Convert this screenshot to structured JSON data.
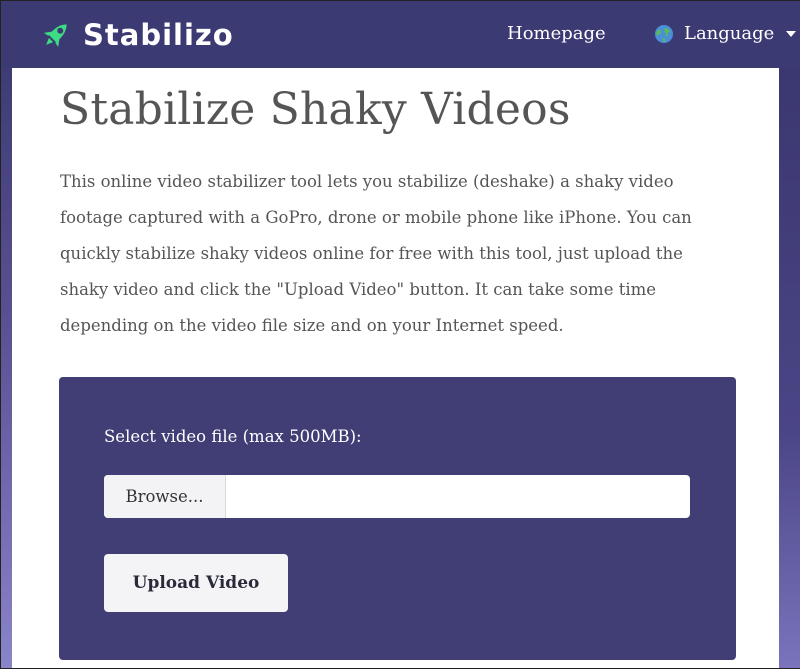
{
  "header": {
    "brand": "Stabilizo",
    "nav": {
      "homepage": "Homepage",
      "language": "Language"
    },
    "icons": {
      "logo": "rocket-icon",
      "language": "globe-icon",
      "dropdown": "caret-down-icon"
    }
  },
  "main": {
    "title": "Stabilize Shaky Videos",
    "intro": "This online video stabilizer tool lets you stabilize (deshake) a shaky video footage captured with a GoPro, drone or mobile phone like iPhone. You can quickly stabilize shaky videos online for free with this tool, just upload the shaky video and click the \"Upload Video\" button. It can take some time depending on the video file size and on your Internet speed.",
    "upload": {
      "file_label": "Select video file (max 500MB):",
      "browse_label": "Browse...",
      "file_value": "",
      "submit_label": "Upload Video"
    }
  },
  "colors": {
    "header_bg": "#3c3a73",
    "panel_bg": "#403e75",
    "logo_accent": "#3ddc84",
    "text": "#555555"
  }
}
